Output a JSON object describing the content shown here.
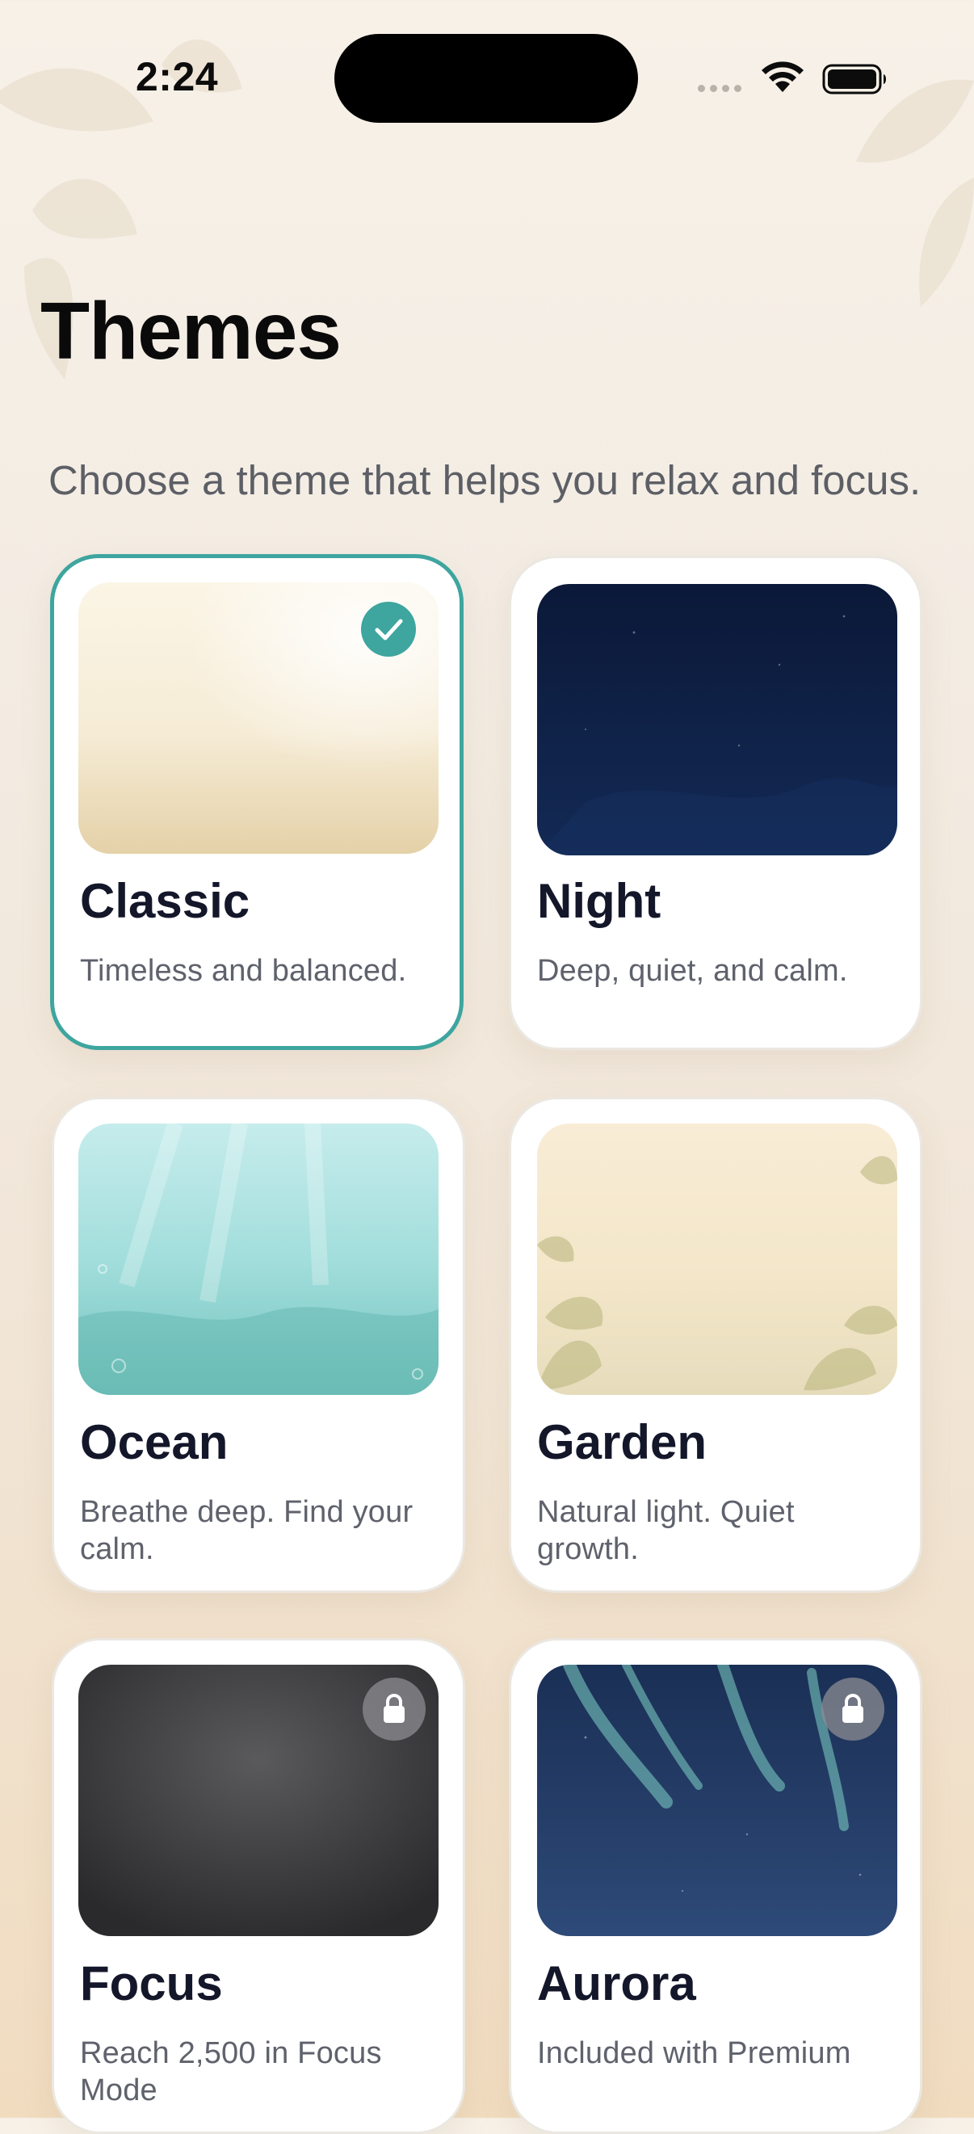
{
  "status_bar": {
    "time": "2:24"
  },
  "header": {
    "title": "Themes",
    "subtitle": "Choose a theme that helps you relax and focus."
  },
  "colors": {
    "accent": "#3ea59f",
    "title": "#0a0a0a",
    "subtitle": "#5d5f66"
  },
  "themes": [
    {
      "name": "Classic",
      "description": "Timeless and balanced.",
      "state": "selected",
      "badge_icon": "checkmark-icon"
    },
    {
      "name": "Night",
      "description": "Deep, quiet, and calm.",
      "state": "available"
    },
    {
      "name": "Ocean",
      "description": "Breathe deep. Find your calm.",
      "state": "available"
    },
    {
      "name": "Garden",
      "description": "Natural light. Quiet growth.",
      "state": "available"
    },
    {
      "name": "Focus",
      "description": "Reach 2,500 in Focus Mode",
      "state": "locked",
      "badge_icon": "lock-icon"
    },
    {
      "name": "Aurora",
      "description": "Included with Premium",
      "state": "locked",
      "badge_icon": "lock-icon"
    }
  ]
}
